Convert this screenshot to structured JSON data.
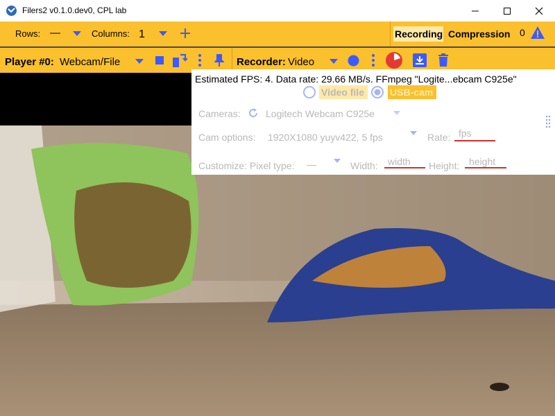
{
  "window": {
    "title": "Filers2 v0.1.0.dev0, CPL lab",
    "app_icon": "kivy-logo-icon"
  },
  "toolbar": {
    "rows_label": "Rows:",
    "rows_value": "—",
    "columns_label": "Columns:",
    "columns_value": "1",
    "recording_label": "Recording",
    "compression_label": "Compression",
    "warning_count": "0"
  },
  "player": {
    "title": "Player #0:",
    "source_value": "Webcam/File",
    "recorder_label": "Recorder:",
    "recorder_value": "Video"
  },
  "panel": {
    "status": "Estimated FPS: 4. Data rate: 29.66 MB/s. FFmpeg \"Logite...ebcam C925e\"",
    "video_file_label": "Video file",
    "usb_cam_label": "USB-cam",
    "cameras_label": "Cameras:",
    "cameras_value": "Logitech Webcam C925e",
    "cam_options_label": "Cam options:",
    "cam_options_value": "1920X1080 yuyv422, 5 fps",
    "rate_label": "Rate:",
    "rate_placeholder": "fps",
    "pixel_type_label": "Customize: Pixel type:",
    "pixel_type_value": "—",
    "width_label": "Width:",
    "width_placeholder": "width",
    "height_label": "Height:",
    "height_placeholder": "height"
  },
  "colors": {
    "toolbar": "#fbc02d",
    "accent": "#3d5afe",
    "record": "#e53935",
    "warning": "#3d5afe",
    "selected_chip": "#ffe9a8"
  }
}
